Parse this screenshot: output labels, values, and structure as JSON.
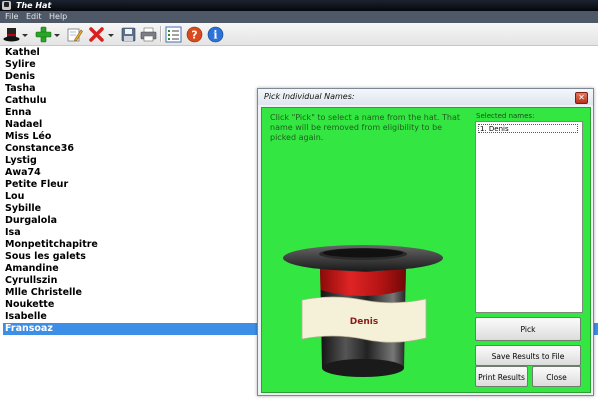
{
  "window": {
    "title": "The Hat"
  },
  "menu": {
    "items": [
      "File",
      "Edit",
      "Help"
    ]
  },
  "toolbar": {
    "buttons": [
      "hat-icon",
      "add-icon",
      "edit-icon",
      "delete-icon",
      "save-icon",
      "print-icon",
      "list-icon",
      "help-icon",
      "info-icon"
    ]
  },
  "names": [
    "Kathel",
    "Sylire",
    "Denis",
    "Tasha",
    "Cathulu",
    "Enna",
    "Nadael",
    "Miss Léo",
    "Constance36",
    "Lystig",
    "Awa74",
    "Petite Fleur",
    "Lou",
    "Sybille",
    "Durgalola",
    "Isa",
    "Monpetitchapitre",
    "Sous les galets",
    "Amandine",
    "Cyrullszin",
    "Mlle Christelle",
    "Noukette",
    "Isabelle",
    "Fransoaz"
  ],
  "selected_name": "Fransoaz",
  "dialog": {
    "title": "Pick Individual Names:",
    "instructions": "Click \"Pick\" to select a name from the hat. That name will be removed from eligibility to be picked again.",
    "selected_label": "Selected names:",
    "selected": [
      "1. Denis"
    ],
    "hat_label": "Denis",
    "buttons": {
      "pick": "Pick",
      "save": "Save Results to File",
      "print": "Print Results",
      "close": "Close"
    }
  },
  "colors": {
    "dialog_bg": "#33e641",
    "selection": "#3d8ee6",
    "hat_band": "#d71c1c",
    "hat_label_text": "#8b1a1a"
  }
}
